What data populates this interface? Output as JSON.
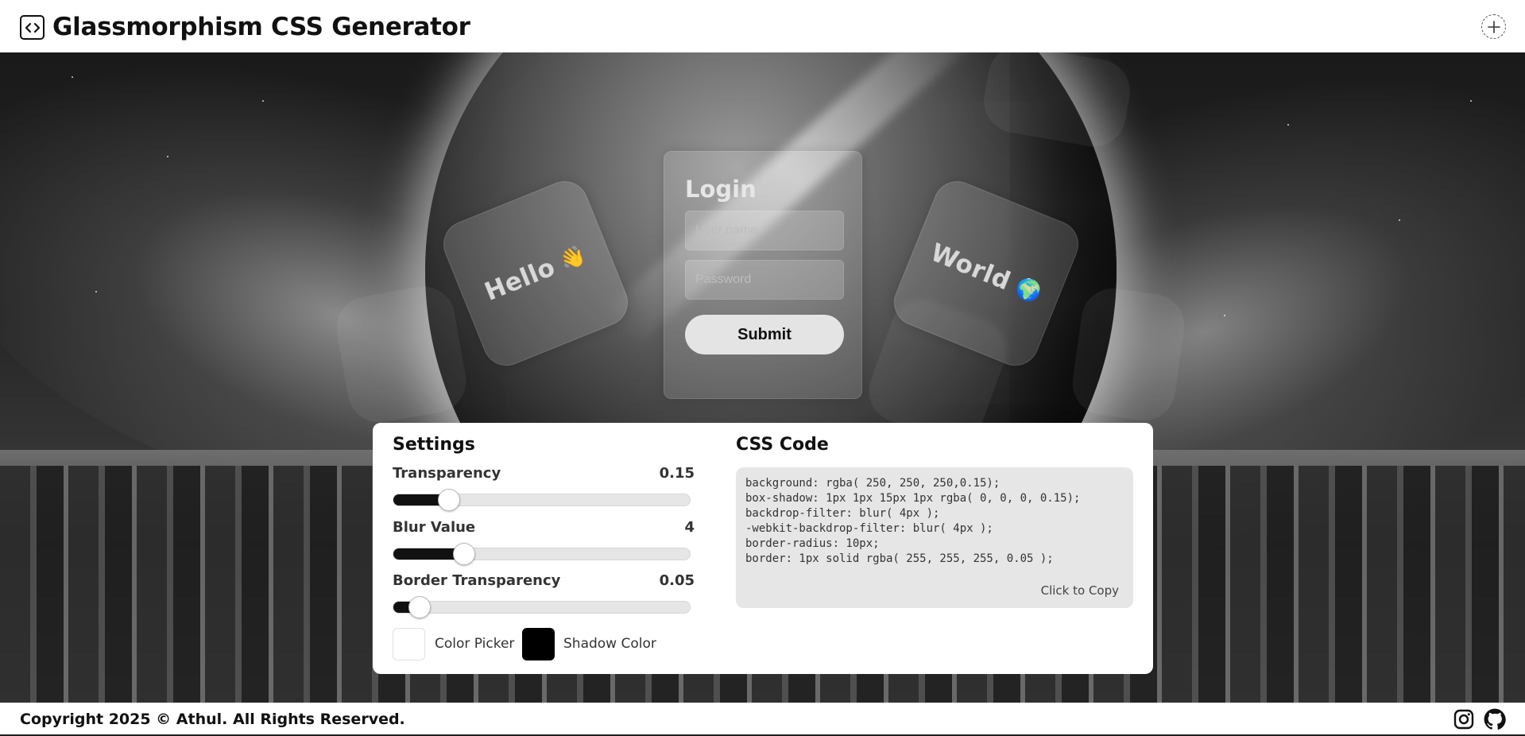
{
  "header": {
    "title": "Glassmorphism CSS Generator",
    "logo_icon": "code-brackets-icon",
    "add_icon": "plus-circle-icon"
  },
  "preview": {
    "hello_card": {
      "text": "Hello",
      "emoji": "👋"
    },
    "world_card": {
      "text": "World",
      "emoji": "🌍"
    },
    "login": {
      "title": "Login",
      "username_placeholder": "User name",
      "password_placeholder": "Password",
      "submit_label": "Submit"
    }
  },
  "settings": {
    "title": "Settings",
    "transparency": {
      "label": "Transparency",
      "value": "0.15",
      "fraction": 0.15
    },
    "blur": {
      "label": "Blur Value",
      "value": "4",
      "fraction": 0.2
    },
    "border_transparency": {
      "label": "Border Transparency",
      "value": "0.05",
      "fraction": 0.05
    },
    "color_picker": {
      "label": "Color Picker",
      "color": "#ffffff"
    },
    "shadow_color": {
      "label": "Shadow Color",
      "color": "#000000"
    }
  },
  "css_code": {
    "title": "CSS Code",
    "lines": [
      "background: rgba( 250, 250, 250,0.15);",
      "box-shadow: 1px 1px 15px 1px rgba( 0, 0, 0, 0.15);",
      "backdrop-filter: blur( 4px );",
      "-webkit-backdrop-filter: blur( 4px );",
      "border-radius: 10px;",
      "border: 1px solid rgba( 255, 255, 255, 0.05 );"
    ],
    "copy_label": "Click to Copy"
  },
  "footer": {
    "copyright": "Copyright 2025 © Athul. All Rights Reserved.",
    "social": [
      "instagram-icon",
      "github-icon"
    ]
  },
  "colors": {
    "accent": "#111111",
    "panel_bg": "#ffffff",
    "code_bg": "#e6e6e6"
  }
}
